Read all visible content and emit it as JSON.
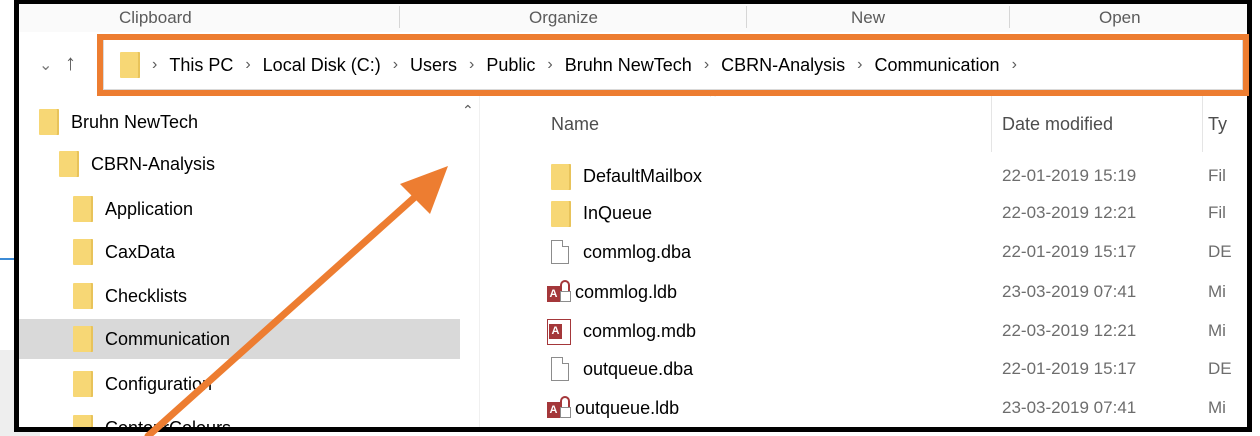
{
  "ribbon": {
    "groups": [
      "Clipboard",
      "Organize",
      "New",
      "Open"
    ]
  },
  "navigation": {
    "back_icon": "chevron-down-icon",
    "up_icon": "up-arrow-icon"
  },
  "address_bar": {
    "crumbs": [
      "This PC",
      "Local Disk (C:)",
      "Users",
      "Public",
      "Bruhn NewTech",
      "CBRN-Analysis",
      "Communication"
    ]
  },
  "sidebar": {
    "items": [
      {
        "label": "Bruhn NewTech",
        "selected": false
      },
      {
        "label": "CBRN-Analysis",
        "selected": false
      },
      {
        "label": "Application",
        "selected": false
      },
      {
        "label": "CaxData",
        "selected": false
      },
      {
        "label": "Checklists",
        "selected": false
      },
      {
        "label": "Communication",
        "selected": true
      },
      {
        "label": "Configuration",
        "selected": false
      },
      {
        "label": "ContourColours",
        "selected": false
      }
    ]
  },
  "file_list": {
    "columns": {
      "name": "Name",
      "date": "Date modified",
      "type": "Ty"
    },
    "rows": [
      {
        "name": "DefaultMailbox",
        "date": "22-01-2019 15:19",
        "type": "Fil",
        "icon": "folder-icon"
      },
      {
        "name": "InQueue",
        "date": "22-03-2019 12:21",
        "type": "Fil",
        "icon": "folder-icon"
      },
      {
        "name": "commlog.dba",
        "date": "22-01-2019 15:17",
        "type": "DE",
        "icon": "file-icon"
      },
      {
        "name": "commlog.ldb",
        "date": "23-03-2019 07:41",
        "type": "Mi",
        "icon": "access-lock-icon"
      },
      {
        "name": "commlog.mdb",
        "date": "22-03-2019 12:21",
        "type": "Mi",
        "icon": "access-database-icon"
      },
      {
        "name": "outqueue.dba",
        "date": "22-01-2019 15:17",
        "type": "DE",
        "icon": "file-icon"
      },
      {
        "name": "outqueue.ldb",
        "date": "23-03-2019 07:41",
        "type": "Mi",
        "icon": "access-lock-icon"
      }
    ]
  },
  "colors": {
    "annotation_orange": "#ed7d31",
    "folder_yellow": "#f7d775",
    "selection_grey": "#d9d9d9",
    "access_red": "#a4373a"
  }
}
